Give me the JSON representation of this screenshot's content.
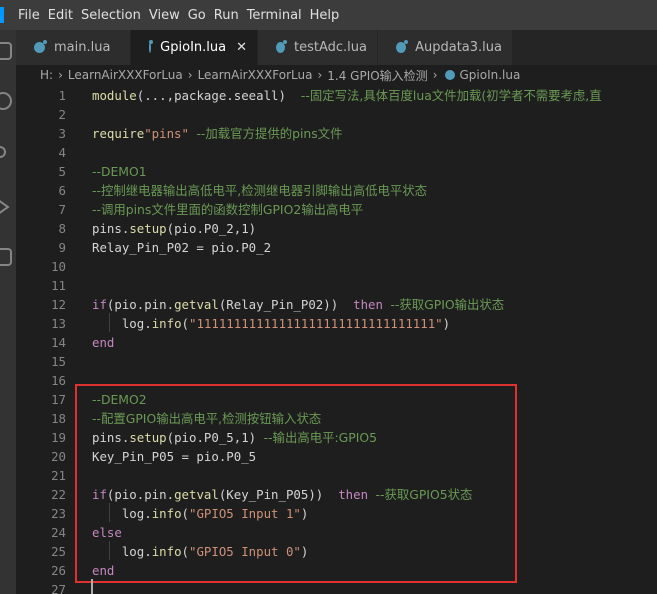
{
  "menubar": {
    "items": [
      "File",
      "Edit",
      "Selection",
      "View",
      "Go",
      "Run",
      "Terminal",
      "Help"
    ]
  },
  "tabs": [
    {
      "label": "main.lua",
      "active": false
    },
    {
      "label": "GpioIn.lua",
      "active": true,
      "close": "✕"
    },
    {
      "label": "testAdc.lua",
      "active": false
    },
    {
      "label": "Aupdata3.lua",
      "active": false
    }
  ],
  "breadcrumb": {
    "parts": [
      "H:",
      "LearnAirXXXForLua",
      "LearnAirXXXForLua",
      "1.4 GPIO输入检测",
      "GpioIn.lua"
    ]
  },
  "editor": {
    "lines": [
      {
        "n": "1",
        "text": "module(...,package.seeall)  --固定写法,具体百度lua文件加载(初学者不需要考虑,直"
      },
      {
        "n": "2",
        "text": ""
      },
      {
        "n": "3",
        "text": "require\"pins\" --加载官方提供的pins文件"
      },
      {
        "n": "4",
        "text": ""
      },
      {
        "n": "5",
        "text": "--DEMO1"
      },
      {
        "n": "6",
        "text": "--控制继电器输出高低电平,检测继电器引脚输出高低电平状态"
      },
      {
        "n": "7",
        "text": "--调用pins文件里面的函数控制GPIO2输出高电平"
      },
      {
        "n": "8",
        "text": "pins.setup(pio.P0_2,1)"
      },
      {
        "n": "9",
        "text": "Relay_Pin_P02 = pio.P0_2"
      },
      {
        "n": "10",
        "text": ""
      },
      {
        "n": "11",
        "text": ""
      },
      {
        "n": "12",
        "text": "if(pio.pin.getval(Relay_Pin_P02))  then --获取GPIO输出状态"
      },
      {
        "n": "13",
        "text": "    log.info(\"11111111111111111111111111111111\")"
      },
      {
        "n": "14",
        "text": "end"
      },
      {
        "n": "15",
        "text": ""
      },
      {
        "n": "16",
        "text": ""
      },
      {
        "n": "17",
        "text": "--DEMO2"
      },
      {
        "n": "18",
        "text": "--配置GPIO输出高电平,检测按钮输入状态"
      },
      {
        "n": "19",
        "text": "pins.setup(pio.P0_5,1) --输出高电平:GPIO5"
      },
      {
        "n": "20",
        "text": "Key_Pin_P05 = pio.P0_5"
      },
      {
        "n": "21",
        "text": ""
      },
      {
        "n": "22",
        "text": "if(pio.pin.getval(Key_Pin_P05))  then --获取GPIO5状态"
      },
      {
        "n": "23",
        "text": "    log.info(\"GPIO5 Input 1\")"
      },
      {
        "n": "24",
        "text": "else"
      },
      {
        "n": "25",
        "text": "    log.info(\"GPIO5 Input 0\")"
      },
      {
        "n": "26",
        "text": "end"
      },
      {
        "n": "27",
        "text": ""
      }
    ]
  },
  "colors": {
    "keyword": "#c586c0",
    "function": "#dcdcaa",
    "string": "#ce9178",
    "comment": "#6a9955",
    "highlight_box": "#e0312f"
  }
}
